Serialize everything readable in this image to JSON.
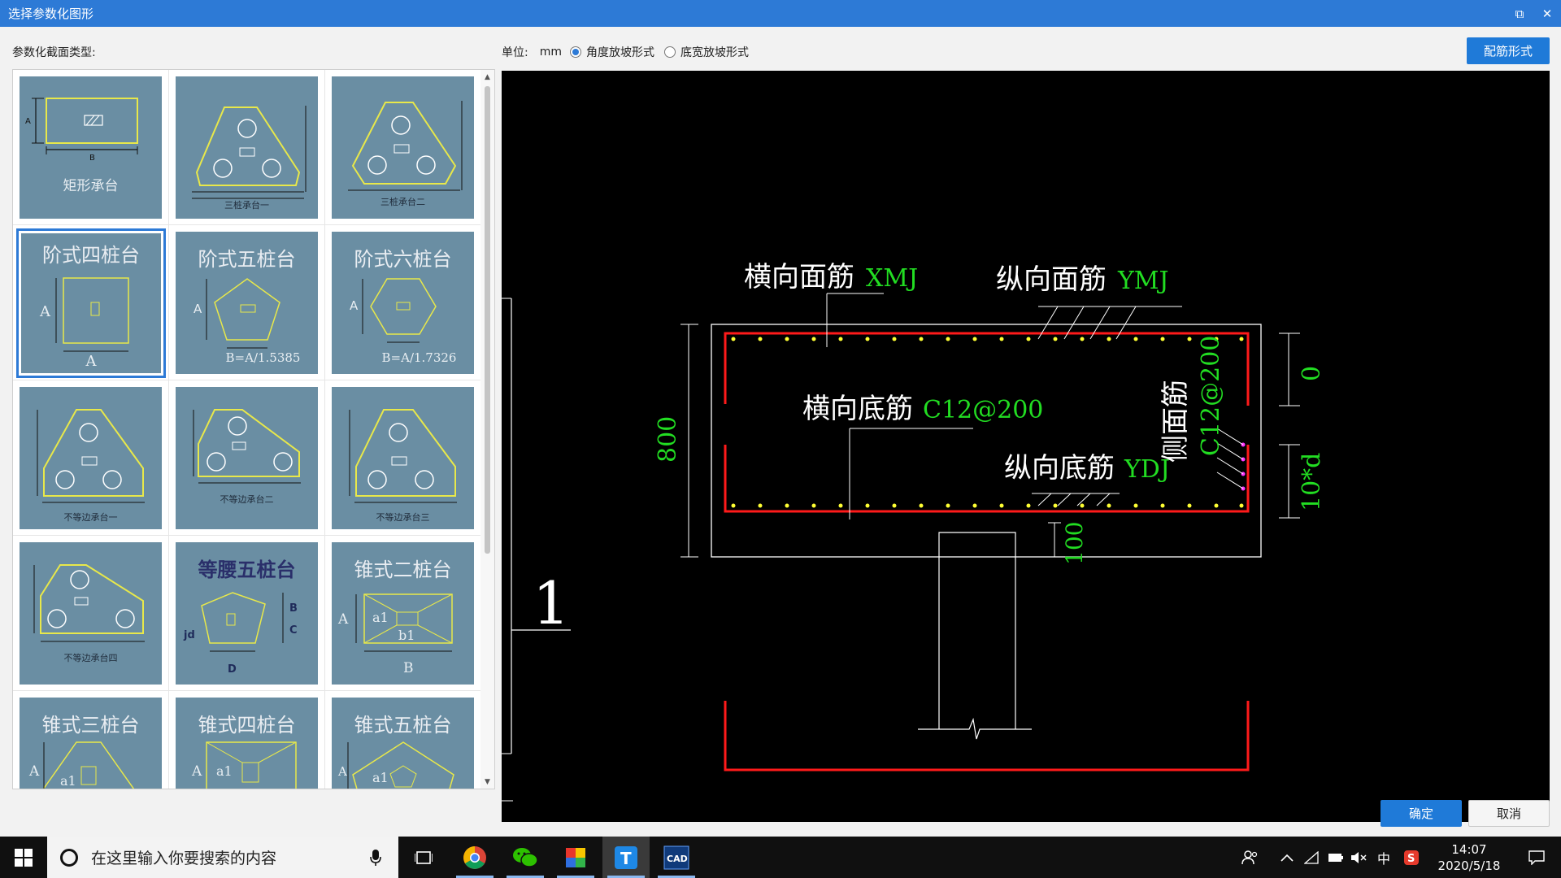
{
  "window": {
    "title": "选择参数化图形",
    "restore_glyph": "⧉",
    "close_glyph": "✕"
  },
  "left": {
    "section_label": "参数化截面类型:",
    "items": [
      {
        "caption": "矩形承台"
      },
      {
        "caption": "三桩承台一"
      },
      {
        "caption": "三桩承台二"
      },
      {
        "title": "阶式四桩台",
        "caption": "A",
        "dim": "A"
      },
      {
        "title": "阶式五桩台",
        "caption": "B=A/1.5385",
        "dim": "A"
      },
      {
        "title": "阶式六桩台",
        "caption": "B=A/1.7326",
        "dim": "A"
      },
      {
        "caption": "不等边承台一"
      },
      {
        "caption": "不等边承台二"
      },
      {
        "caption": "不等边承台三"
      },
      {
        "caption": "不等边承台四"
      },
      {
        "title": "等腰五桩台",
        "labels": [
          "B",
          "C",
          "jd",
          "D"
        ]
      },
      {
        "title": "锥式二桩台",
        "labels": [
          "A",
          "a1",
          "b1",
          "B"
        ]
      },
      {
        "title": "锥式三桩台",
        "labels": [
          "A",
          "a1"
        ]
      },
      {
        "title": "锥式四桩台",
        "labels": [
          "A",
          "a1"
        ]
      },
      {
        "title": "锥式五桩台",
        "labels": [
          "A",
          "a1"
        ]
      }
    ],
    "rect_labels": {
      "a": "A",
      "b": "B"
    }
  },
  "options": {
    "unit_label": "单位:",
    "unit_value": "mm",
    "radio1": "角度放坡形式",
    "radio2": "底宽放坡形式",
    "radio1_selected": true,
    "rebar_button": "配筋形式"
  },
  "drawing": {
    "xmj_cn": "横向面筋",
    "xmj_code": "XMJ",
    "ymj_cn": "纵向面筋",
    "ymj_code": "YMJ",
    "xdj_cn": "横向底筋",
    "xdj_code": "C12@200",
    "ydj_cn": "纵向底筋",
    "ydj_code": "YDJ",
    "side_cn": "侧面筋",
    "side_code": "C12@200",
    "dim_height": "800",
    "dim_cover_top": "0",
    "dim_anchor": "10*d",
    "dim_cover_bottom": "100",
    "section_mark": "1"
  },
  "footer": {
    "ok": "确定",
    "cancel": "取消"
  },
  "taskbar": {
    "search_placeholder": "在这里输入你要搜索的内容",
    "tray_ime": "中",
    "time": "14:07",
    "date": "2020/5/18"
  },
  "colors": {
    "accent": "#2d7ad6",
    "thumb_bg": "#6a8ea3",
    "thumb_line": "#e8e84a",
    "cad_green": "#22dd22",
    "cad_red": "#ff1a1a",
    "cad_yellow": "#ffff33",
    "cad_magenta": "#ff33ff"
  }
}
